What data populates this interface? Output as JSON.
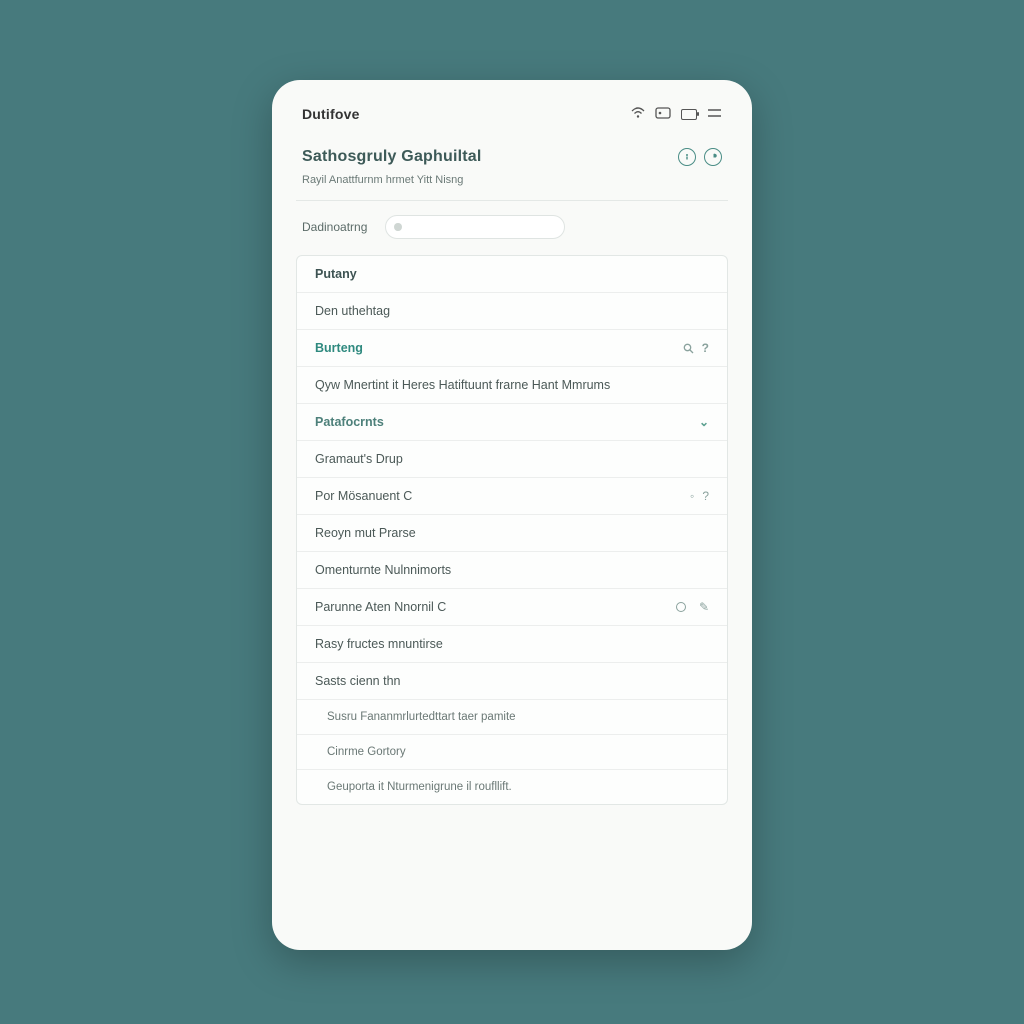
{
  "statusbar": {
    "brand": "Dutifove"
  },
  "header": {
    "title": "Sathosgruly Gaphuiltal",
    "subtitle": "Rayil Anattfurnm hrmet Yitt Nisng"
  },
  "search": {
    "label": "Dadinoatrng",
    "placeholder": ""
  },
  "rows": [
    {
      "label": "Putany",
      "kind": "head"
    },
    {
      "label": "Den uthehtag",
      "kind": "plain"
    },
    {
      "label": "Burteng",
      "kind": "teal",
      "right": "search"
    },
    {
      "label": "Qyw Mnertint it Heres Hatiftuunt frarne Hant Mmrums",
      "kind": "plain"
    },
    {
      "label": "Patafocrnts",
      "kind": "section",
      "right": "chev"
    },
    {
      "label": "Gramaut's Drup",
      "kind": "plain"
    },
    {
      "label": "Por Mösanuent C",
      "kind": "plain",
      "right": "dots"
    },
    {
      "label": "Reoyn mut Prarse",
      "kind": "plain"
    },
    {
      "label": "Omenturnte Nulnnimorts",
      "kind": "plain"
    },
    {
      "label": "Parunne Aten Nnornil C",
      "kind": "plain",
      "right": "gear"
    },
    {
      "label": "Rasy fructes mnuntirse",
      "kind": "plain"
    },
    {
      "label": "Sasts cienn thn",
      "kind": "plain"
    },
    {
      "label": "Susru Fananmrlurtedttart taer pamite",
      "kind": "sub"
    },
    {
      "label": "Cinrme Gortory",
      "kind": "sub"
    },
    {
      "label": "Geuporta it Nturmenigrune il roufllift.",
      "kind": "sub"
    }
  ]
}
